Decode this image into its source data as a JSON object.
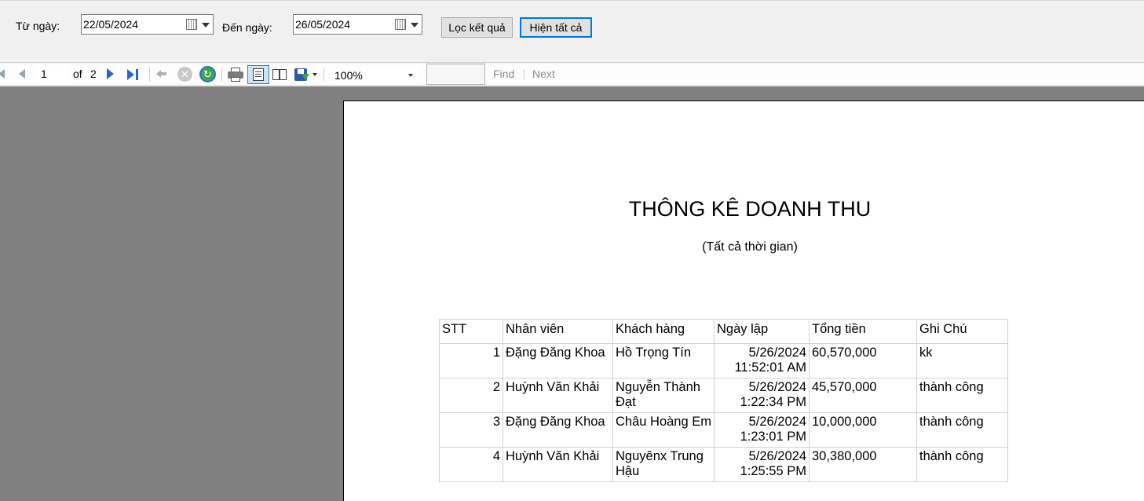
{
  "filter": {
    "from_label": "Từ ngày:",
    "from_value": "22/05/2024",
    "to_label": "Đến ngày:",
    "to_value": "26/05/2024",
    "filter_button": "Lọc kết quả",
    "show_all_button": "Hiện tất cả"
  },
  "toolbar": {
    "current_page": "1",
    "of_label": "of",
    "total_pages": "2",
    "zoom": "100%",
    "find_label": "Find",
    "next_label": "Next"
  },
  "report": {
    "title": "THÔNG KÊ DOANH THU",
    "subtitle": "(Tất cả thời gian)",
    "columns": [
      "STT",
      "Nhân viên",
      "Khách hàng",
      "Ngày lập",
      "Tổng tiền",
      "Ghi Chú"
    ],
    "rows": [
      {
        "stt": "1",
        "nhan_vien": "Đặng Đăng Khoa",
        "khach_hang": "Hồ Trọng Tín",
        "ngay": "5/26/2024",
        "gio": "11:52:01 AM",
        "tong_tien": "60,570,000",
        "ghi_chu": "kk"
      },
      {
        "stt": "2",
        "nhan_vien": "Huỳnh Văn Khải",
        "khach_hang": "Nguyễn Thành Đạt",
        "ngay": "5/26/2024",
        "gio": "1:22:34 PM",
        "tong_tien": "45,570,000",
        "ghi_chu": "thành công"
      },
      {
        "stt": "3",
        "nhan_vien": "Đặng Đăng Khoa",
        "khach_hang": "Châu Hoàng Em",
        "ngay": "5/26/2024",
        "gio": "1:23:01 PM",
        "tong_tien": "10,000,000",
        "ghi_chu": "thành công"
      },
      {
        "stt": "4",
        "nhan_vien": "Huỳnh Văn Khải",
        "khach_hang": "Nguyênx Trung Hậu",
        "ngay": "5/26/2024",
        "gio": "1:25:55 PM",
        "tong_tien": "30,380,000",
        "ghi_chu": "thành công"
      }
    ]
  }
}
